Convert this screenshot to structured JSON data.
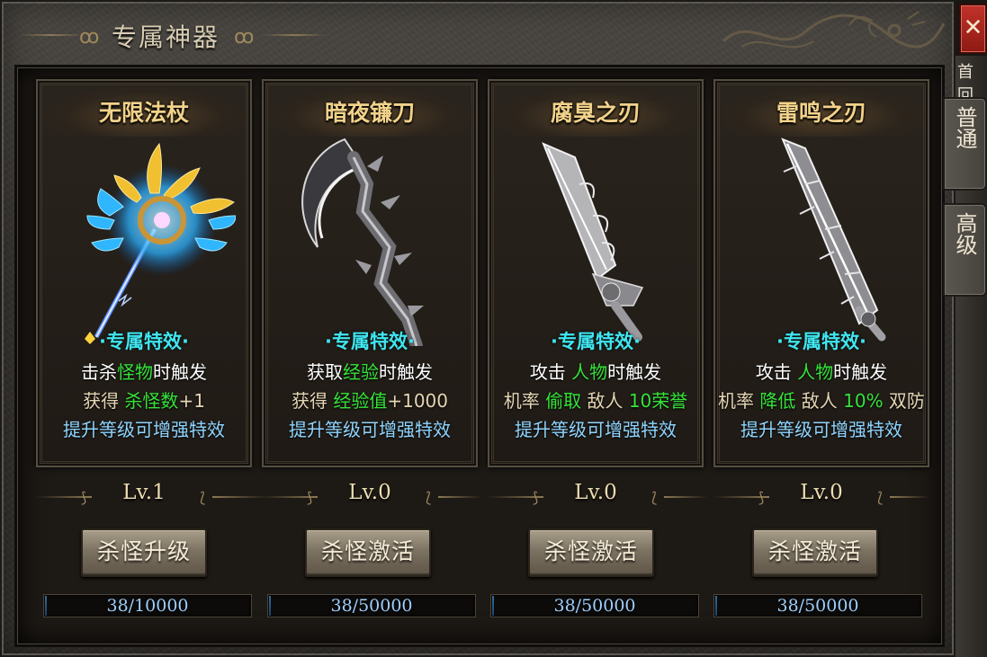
{
  "window": {
    "title": "专属神器",
    "close_label": "✕"
  },
  "side_tabs": [
    {
      "label": "普通"
    },
    {
      "label": "高级"
    }
  ],
  "side_label_partial": "首回",
  "cards": [
    {
      "name": "无限法杖",
      "effect_head": "·专属特效·",
      "line1": {
        "pre": "击杀",
        "hl": "怪物",
        "post": "时触发"
      },
      "line2": {
        "pre": "获得 ",
        "hl": "杀怪数",
        "post": "+1"
      },
      "line3": "提升等级可增强特效",
      "level": "Lv.1",
      "button": "杀怪升级",
      "progress_text": "38/10000",
      "progress": 0.0038,
      "weapon_icon": "winged-staff-icon"
    },
    {
      "name": "暗夜镰刀",
      "effect_head": "·专属特效·",
      "line1": {
        "pre": "获取",
        "hl": "经验",
        "post": "时触发"
      },
      "line2": {
        "pre": "获得 ",
        "hl": "经验值",
        "post": "+1000"
      },
      "line3": "提升等级可增强特效",
      "level": "Lv.0",
      "button": "杀怪激活",
      "progress_text": "38/50000",
      "progress": 0.00076,
      "weapon_icon": "dark-scythe-icon"
    },
    {
      "name": "腐臭之刃",
      "effect_head": "·专属特效·",
      "line1": {
        "pre": "攻击 ",
        "hl": "人物",
        "post": "时触发"
      },
      "line2": {
        "pre": "机率 ",
        "hl": "偷取",
        "post": " 敌人 ",
        "hl2": "10荣誉"
      },
      "line3": "提升等级可增强特效",
      "level": "Lv.0",
      "button": "杀怪激活",
      "progress_text": "38/50000",
      "progress": 0.00076,
      "weapon_icon": "rot-blade-icon"
    },
    {
      "name": "雷鸣之刃",
      "effect_head": "·专属特效·",
      "line1": {
        "pre": "攻击 ",
        "hl": "人物",
        "post": "时触发"
      },
      "line2": {
        "pre": "机率 ",
        "hl": "降低",
        "post": " 敌人 ",
        "hl2": "10%",
        "post2": " 双防"
      },
      "line3": "提升等级可增强特效",
      "level": "Lv.0",
      "button": "杀怪激活",
      "progress_text": "38/50000",
      "progress": 0.00076,
      "weapon_icon": "thunder-blade-icon"
    }
  ]
}
